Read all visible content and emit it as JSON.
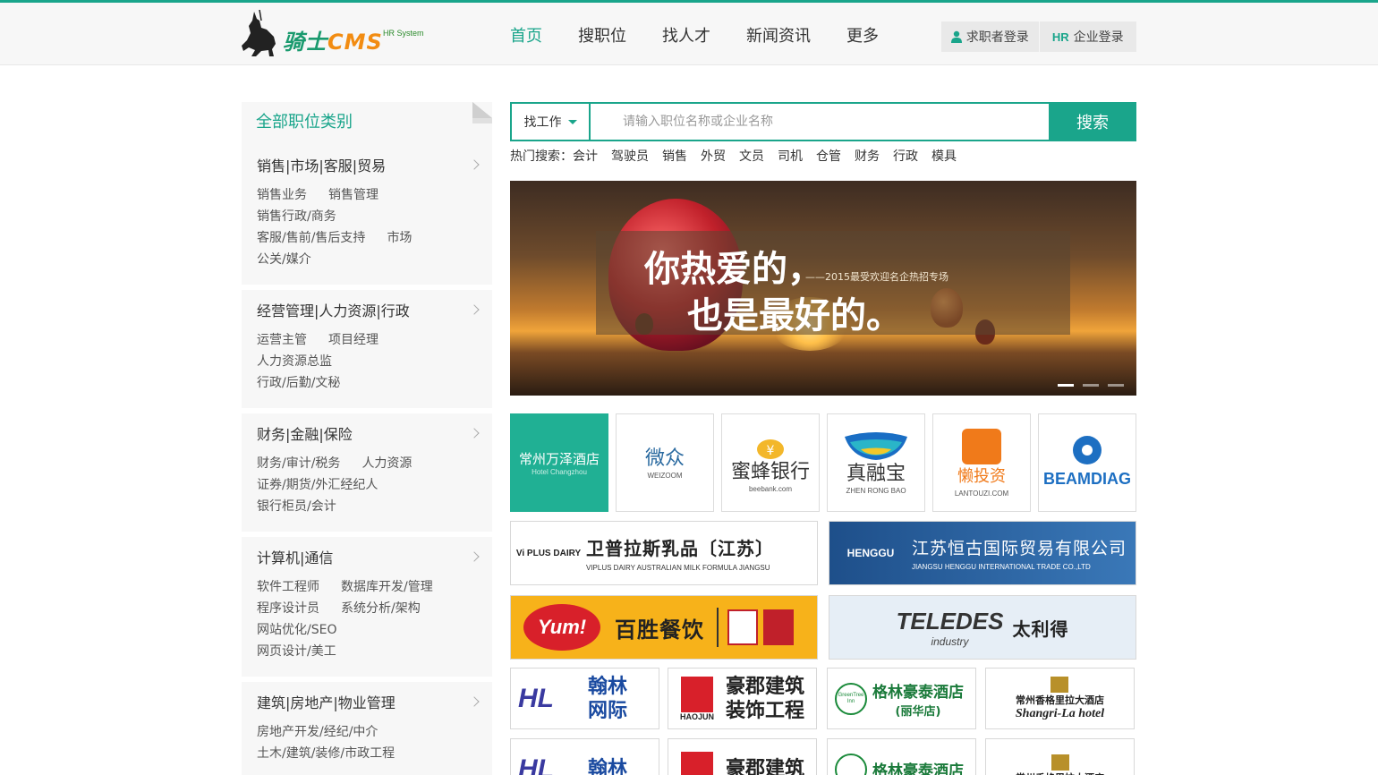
{
  "header": {
    "logo": {
      "brand_cn": "骑士",
      "brand_en": "CMS",
      "sub": "HR System"
    },
    "nav": [
      "首页",
      "搜职位",
      "找人才",
      "新闻资讯",
      "更多"
    ],
    "login": {
      "seeker": "求职者登录",
      "hr_icon": "HR",
      "company": "企业登录"
    }
  },
  "sidebar": {
    "title": "全部职位类别",
    "categories": [
      {
        "title": "销售|市场|客服|贸易",
        "lines": [
          [
            "销售业务",
            "销售管理"
          ],
          [
            "销售行政/商务"
          ],
          [
            "客服/售前/售后支持",
            "市场"
          ],
          [
            "公关/媒介"
          ]
        ]
      },
      {
        "title": "经营管理|人力资源|行政",
        "lines": [
          [
            "运营主管",
            "项目经理"
          ],
          [
            "人力资源总监"
          ],
          [
            "行政/后勤/文秘"
          ]
        ]
      },
      {
        "title": "财务|金融|保险",
        "lines": [
          [
            "财务/审计/税务",
            "人力资源"
          ],
          [
            "证券/期货/外汇经纪人"
          ],
          [
            "银行柜员/会计"
          ]
        ]
      },
      {
        "title": "计算机|通信",
        "lines": [
          [
            "软件工程师",
            "数据库开发/管理"
          ],
          [
            "程序设计员",
            "系统分析/架构"
          ],
          [
            "网站优化/SEO"
          ],
          [
            "网页设计/美工"
          ]
        ]
      },
      {
        "title": "建筑|房地产|物业管理",
        "lines": [
          [
            "房地产开发/经纪/中介"
          ],
          [
            "土木/建筑/装修/市政工程"
          ]
        ]
      }
    ]
  },
  "search": {
    "type": "找工作",
    "placeholder": "请输入职位名称或企业名称",
    "button": "搜索",
    "hot_label": "热门搜索：",
    "hot": [
      "会计",
      "驾驶员",
      "销售",
      "外贸",
      "文员",
      "司机",
      "仓管",
      "财务",
      "行政",
      "模具"
    ]
  },
  "banner": {
    "line1": "你热爱的，",
    "line2": "也是最好的。",
    "sub": "——2015最受欢迎名企热招专场"
  },
  "companies": {
    "row1": [
      {
        "cn": "常州万泽酒店",
        "en": "Hotel Changzhou"
      },
      {
        "cn": "微众",
        "en": "WEIZOOM"
      },
      {
        "cn": "蜜蜂银行",
        "en": "beebank.com"
      },
      {
        "cn": "真融宝",
        "en": "ZHEN RONG BAO"
      },
      {
        "cn": "懒投资",
        "en": "LANTOUZI.COM"
      },
      {
        "cn": "BEAMDIAG",
        "en": ""
      }
    ],
    "wide": [
      {
        "cn": "卫普拉斯乳品〔江苏〕",
        "en": "VIPLUS DAIRY  AUSTRALIAN  MILK FORMULA JIANGSU",
        "mark": "Vi PLUS DAIRY"
      },
      {
        "cn": "江苏恒古国际贸易有限公司",
        "en": "JIANGSU HENGGU INTERNATIONAL TRADE CO.,LTD",
        "mark": "HENGGU"
      },
      {
        "cn": "百胜餐饮",
        "en": "",
        "mark": "Yum!"
      },
      {
        "cn": "太利得",
        "en": "industry",
        "mark": "TELEDES"
      }
    ],
    "small": [
      {
        "cn1": "翰林",
        "cn2": "网际",
        "mark": "HL"
      },
      {
        "cn1": "豪郡建筑",
        "cn2": "装饰工程",
        "mark": "HAOJUN"
      },
      {
        "cn1": "格林豪泰酒店",
        "cn2": "(丽华店)",
        "mark": "GreenTree Inn"
      },
      {
        "cn1": "常州香格里拉大酒店",
        "cn2": "Shangri-La hotel",
        "mark": ""
      }
    ]
  },
  "colors": {
    "accent": "#1aa58b",
    "logo_orange": "#f28c12"
  }
}
